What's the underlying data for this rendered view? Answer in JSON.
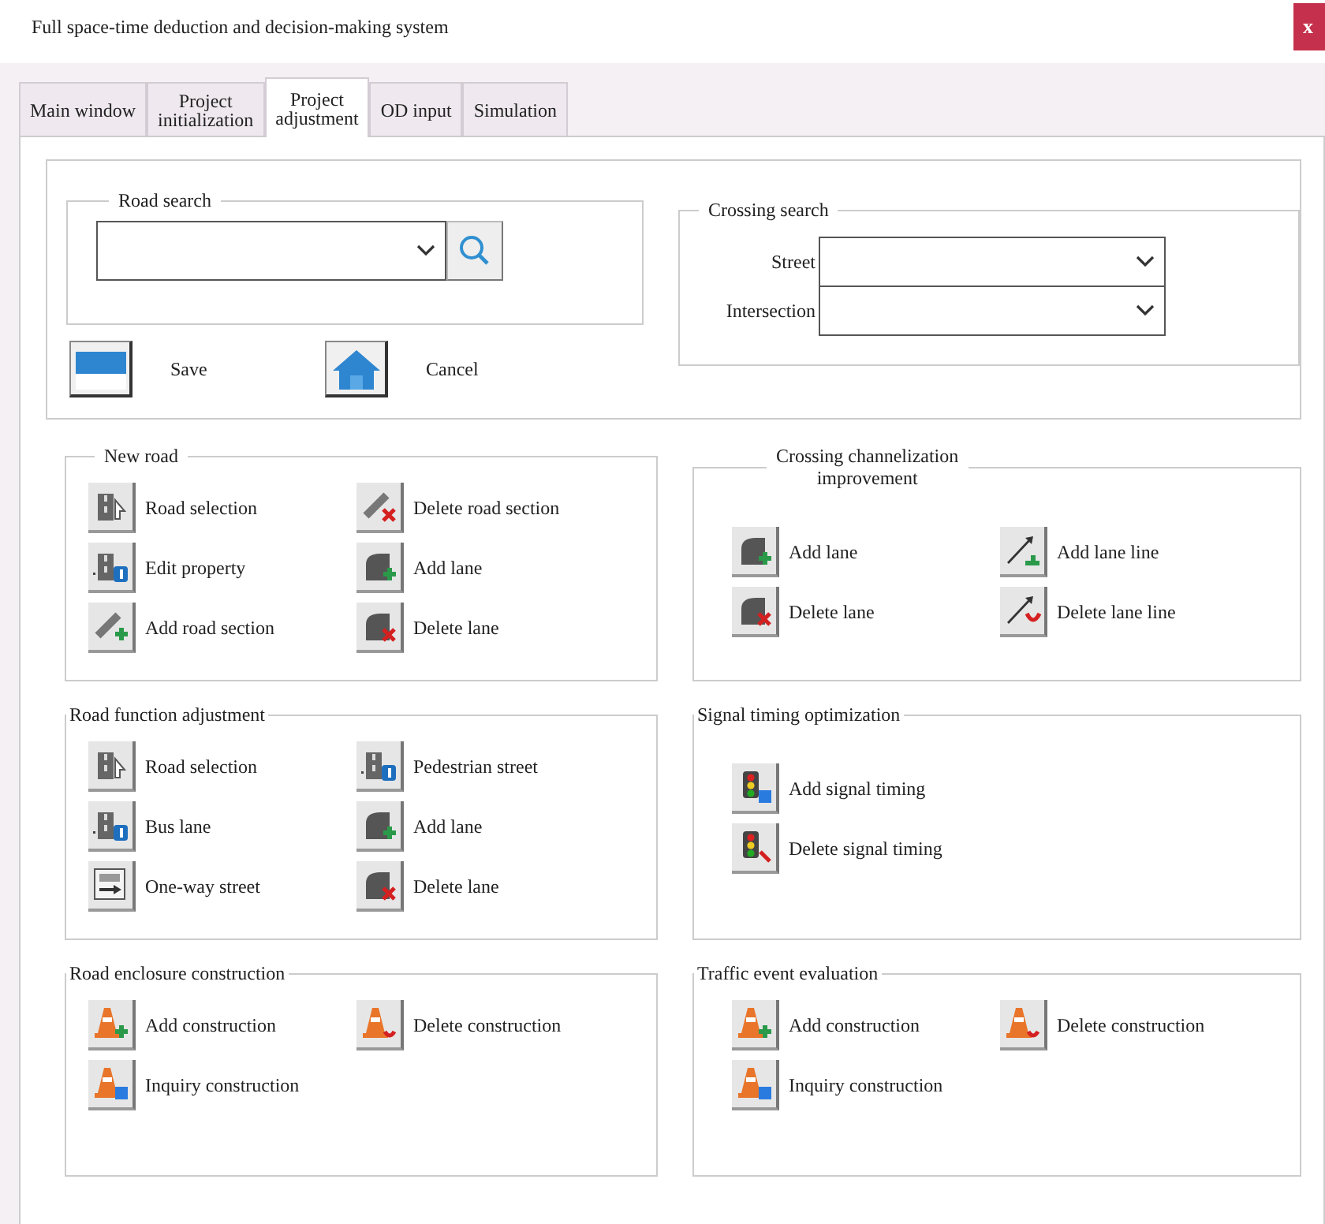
{
  "window": {
    "title": "Full space-time deduction and decision-making system",
    "close": "x"
  },
  "tabs": [
    {
      "label": "Main window",
      "selected": false
    },
    {
      "label": "Project\ninitialization",
      "selected": false
    },
    {
      "label": "Project\nadjustment",
      "selected": true
    },
    {
      "label": "OD input",
      "selected": false
    },
    {
      "label": "Simulation",
      "selected": false
    }
  ],
  "road_search": {
    "title": "Road search"
  },
  "crossing_search": {
    "title": "Crossing search",
    "fields": [
      {
        "label": "Street"
      },
      {
        "label": "Intersection"
      }
    ]
  },
  "actions": [
    {
      "label": "Save",
      "kind": "save"
    },
    {
      "label": "Cancel",
      "kind": "home"
    }
  ],
  "groups": [
    {
      "title": "New road",
      "tools": [
        {
          "label": "Road selection",
          "kind": "road-select"
        },
        {
          "label": "Delete road section",
          "kind": "road-delete"
        },
        {
          "label": "Edit property",
          "kind": "road-info"
        },
        {
          "label": "Add lane",
          "kind": "lane-add"
        },
        {
          "label": "Add road section",
          "kind": "road-add"
        },
        {
          "label": "Delete lane",
          "kind": "lane-delete"
        }
      ]
    },
    {
      "title": "Crossing channelization\nimprovement",
      "tools": [
        {
          "label": "Add lane",
          "kind": "lane-add"
        },
        {
          "label": "Add lane line",
          "kind": "line-add"
        },
        {
          "label": "Delete lane",
          "kind": "lane-delete"
        },
        {
          "label": "Delete lane line",
          "kind": "line-delete"
        }
      ]
    },
    {
      "title": "Road function adjustment",
      "tools": [
        {
          "label": "Road selection",
          "kind": "road-select"
        },
        {
          "label": "Pedestrian street",
          "kind": "road-info"
        },
        {
          "label": "Bus lane",
          "kind": "road-info"
        },
        {
          "label": "Add lane",
          "kind": "lane-add"
        },
        {
          "label": "One-way street",
          "kind": "one-way"
        },
        {
          "label": "Delete lane",
          "kind": "lane-delete"
        }
      ]
    },
    {
      "title": "Signal timing optimization",
      "tools": [
        {
          "label": "Add signal timing",
          "kind": "signal-add"
        },
        {
          "label": "Delete signal timing",
          "kind": "signal-delete"
        }
      ]
    },
    {
      "title": "Road enclosure construction",
      "tools": [
        {
          "label": "Add construction",
          "kind": "cone-add"
        },
        {
          "label": "Delete construction",
          "kind": "cone-delete"
        },
        {
          "label": "Inquiry construction",
          "kind": "cone-info"
        }
      ]
    },
    {
      "title": "Traffic event evaluation",
      "tools": [
        {
          "label": "Add construction",
          "kind": "cone-add"
        },
        {
          "label": "Delete construction",
          "kind": "cone-delete"
        },
        {
          "label": "Inquiry construction",
          "kind": "cone-info"
        }
      ]
    }
  ]
}
